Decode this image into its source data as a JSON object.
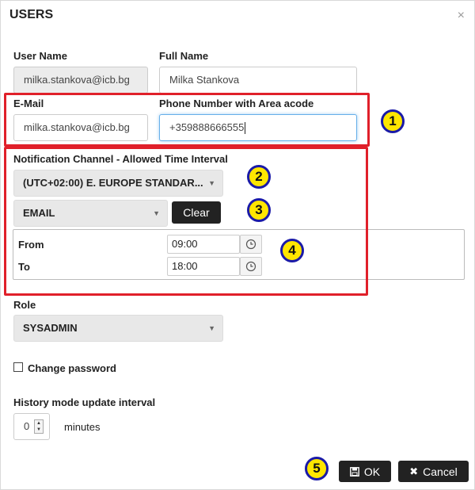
{
  "dialog": {
    "title": "USERS",
    "close_symbol": "×"
  },
  "fields": {
    "user_name_label": "User Name",
    "user_name_value": "milka.stankova@icb.bg",
    "full_name_label": "Full Name",
    "full_name_value": "Milka Stankova",
    "email_label": "E-Mail",
    "email_value": "milka.stankova@icb.bg",
    "phone_label": "Phone Number with Area acode",
    "phone_value": "+359888666555"
  },
  "notification": {
    "label": "Notification Channel - Allowed Time Interval",
    "timezone_value": "(UTC+02:00) E. EUROPE STANDAR...",
    "channel_value": "EMAIL",
    "clear_label": "Clear",
    "from_label": "From",
    "from_value": "09:00",
    "to_label": "To",
    "to_value": "18:00"
  },
  "role": {
    "label": "Role",
    "value": "SYSADMIN"
  },
  "change_password": {
    "label": "Change password",
    "checked": false
  },
  "history": {
    "label": "History mode update interval",
    "value": "0",
    "unit": "minutes"
  },
  "footer": {
    "ok_label": "OK",
    "cancel_label": "Cancel"
  },
  "annotations": [
    "1",
    "2",
    "3",
    "4",
    "5"
  ],
  "colors": {
    "highlight_box": "#e0202a",
    "badge_fill": "#ffe600",
    "badge_border": "#1a1aa8",
    "button_dark": "#222222",
    "focus_border": "#66afe9"
  },
  "icons": {
    "close": "close-icon",
    "clock": "clock-icon",
    "save": "floppy-disk-icon",
    "cancel": "x-icon",
    "dropdown": "caret-down-icon"
  }
}
